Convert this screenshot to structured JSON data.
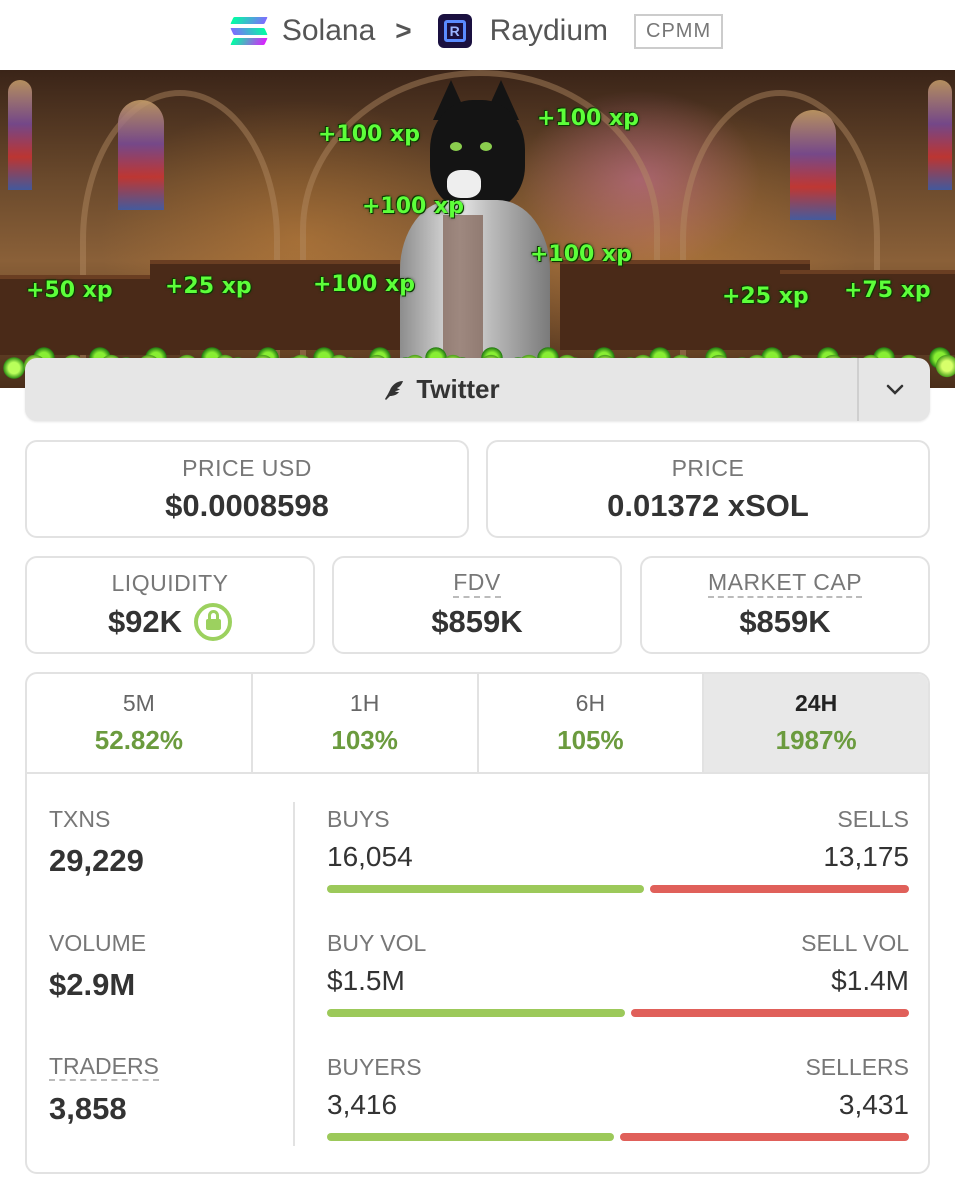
{
  "breadcrumb": {
    "chain": "Solana",
    "separator": ">",
    "dex": "Raydium",
    "pool_type": "CPMM"
  },
  "banner": {
    "xp_labels": [
      "+100 xp",
      "+100 xp",
      "+100 xp",
      "+100 xp",
      "+100 xp",
      "+50 xp",
      "+25 xp",
      "+25 xp",
      "+75 xp"
    ]
  },
  "social": {
    "twitter_label": "Twitter",
    "icon": "feather-icon",
    "dropdown_icon": "chevron-down-icon"
  },
  "price": {
    "usd_label": "PRICE USD",
    "usd_value": "$0.0008598",
    "native_label": "PRICE",
    "native_value": "0.01372 xSOL"
  },
  "metrics": {
    "liquidity_label": "LIQUIDITY",
    "liquidity_value": "$92K",
    "fdv_label": "FDV",
    "fdv_value": "$859K",
    "mcap_label": "MARKET CAP",
    "mcap_value": "$859K"
  },
  "timeframes": [
    {
      "label": "5M",
      "change": "52.82%"
    },
    {
      "label": "1H",
      "change": "103%"
    },
    {
      "label": "6H",
      "change": "105%"
    },
    {
      "label": "24H",
      "change": "1987%",
      "active": true
    }
  ],
  "stats": {
    "txns_label": "TXNS",
    "txns_value": "29,229",
    "volume_label": "VOLUME",
    "volume_value": "$2.9M",
    "traders_label": "TRADERS",
    "traders_value": "3,858",
    "buys_label": "BUYS",
    "buys_value": "16,054",
    "sells_label": "SELLS",
    "sells_value": "13,175",
    "buy_vol_label": "BUY VOL",
    "buy_vol_value": "$1.5M",
    "sell_vol_label": "SELL VOL",
    "sell_vol_value": "$1.4M",
    "buyers_label": "BUYERS",
    "buyers_value": "3,416",
    "sellers_label": "SELLERS",
    "sellers_value": "3,431",
    "buy_share_txns": 0.549,
    "buy_share_vol": 0.517,
    "buy_share_traders": 0.499
  },
  "colors": {
    "positive": "#6b9b3e",
    "buy_bar": "#9cc95a",
    "sell_bar": "#e0605a"
  }
}
